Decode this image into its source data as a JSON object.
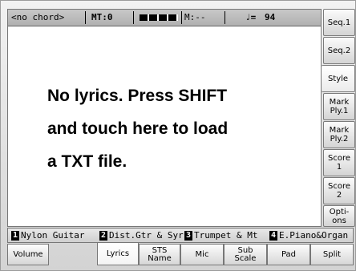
{
  "status": {
    "chord": "<no chord>",
    "measure": "MT:0",
    "marker": "M:--",
    "tempo_symbol": "♩=",
    "tempo_value": "94"
  },
  "lyrics": {
    "lines": [
      "No lyrics. Press SHIFT",
      "and touch here to load",
      "a TXT file."
    ]
  },
  "side_buttons": [
    {
      "label": "Seq.1"
    },
    {
      "label": "Seq.2"
    },
    {
      "label": "Style"
    },
    {
      "label": "Mark Ply.1"
    },
    {
      "label": "Mark Ply.2"
    },
    {
      "label": "Score 1"
    },
    {
      "label": "Score 2"
    },
    {
      "label": "Opti- ons"
    }
  ],
  "tracks": [
    {
      "num": "1",
      "name": "Nylon Guitar"
    },
    {
      "num": "2",
      "name": "Dist.Gtr & Syr"
    },
    {
      "num": "3",
      "name": "Trumpet & Mt"
    },
    {
      "num": "4",
      "name": "E.Piano&Organ"
    }
  ],
  "tabs": [
    {
      "label": "Volume"
    },
    {
      "label": "Lyrics"
    },
    {
      "label": "STS Name"
    },
    {
      "label": "Mic"
    },
    {
      "label": "Sub Scale"
    },
    {
      "label": "Pad"
    },
    {
      "label": "Split"
    }
  ]
}
